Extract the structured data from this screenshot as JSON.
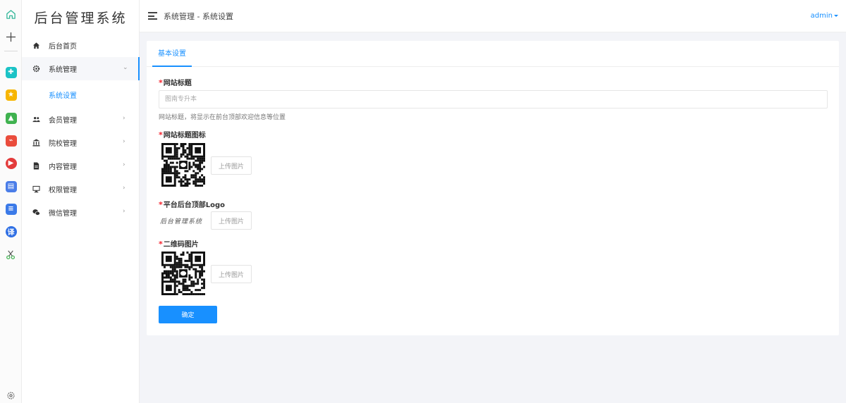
{
  "sidebar": {
    "brand": "后台管理系统",
    "items": [
      {
        "label": "后台首页",
        "icon": "home-icon"
      },
      {
        "label": "系统管理",
        "icon": "gear-icon",
        "expanded": true
      },
      {
        "label": "系统设置",
        "active": true
      },
      {
        "label": "会员管理",
        "icon": "users-icon"
      },
      {
        "label": "院校管理",
        "icon": "bank-icon"
      },
      {
        "label": "内容管理",
        "icon": "document-icon"
      },
      {
        "label": "权限管理",
        "icon": "monitor-icon"
      },
      {
        "label": "微信管理",
        "icon": "wechat-icon"
      }
    ]
  },
  "header": {
    "breadcrumb": "系统管理 - 系统设置",
    "user": "admin"
  },
  "tabs": [
    {
      "label": "基本设置",
      "active": true
    }
  ],
  "form": {
    "site_title": {
      "label": "网站标题",
      "value": "",
      "placeholder": "图南专升本",
      "hint": "网站标题，将显示在前台顶部欢迎信息等位置"
    },
    "site_icon": {
      "label": "网站标题图标",
      "upload_label": "上传图片"
    },
    "top_logo": {
      "label": "平台后台顶部Logo",
      "preview_text": "后台管理系统",
      "upload_label": "上传图片"
    },
    "qr_image": {
      "label": "二维码图片",
      "upload_label": "上传图片"
    },
    "submit_label": "确定"
  },
  "colors": {
    "accent": "#1890ff",
    "required": "#f5222d",
    "background": "#f3f4f8"
  }
}
